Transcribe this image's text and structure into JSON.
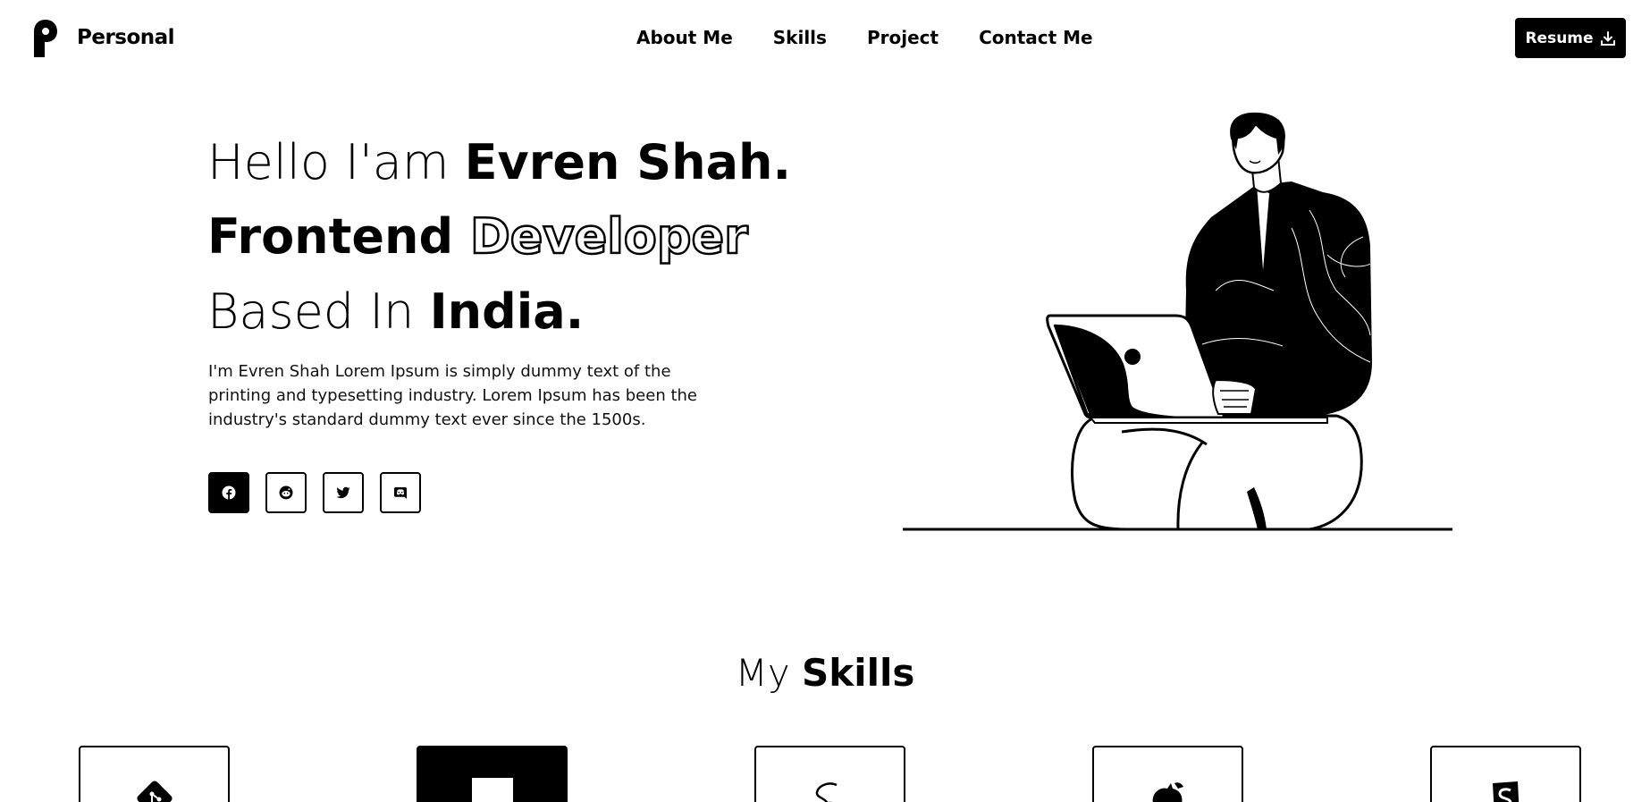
{
  "brand": {
    "name": "Personal",
    "logo_icon": "p-logo-icon"
  },
  "nav": {
    "items": [
      {
        "label": "About Me"
      },
      {
        "label": "Skills"
      },
      {
        "label": "Project"
      },
      {
        "label": "Contact Me"
      }
    ]
  },
  "resume": {
    "label": "Resume",
    "icon": "download-icon"
  },
  "hero": {
    "line1_light": "Hello I'am ",
    "line1_bold": "Evren Shah.",
    "line2_bold": "Frontend ",
    "line2_outline": "Developer",
    "line3_light": "Based In ",
    "line3_bold": "India.",
    "description": "I'm Evren Shah Lorem Ipsum is simply dummy text of the printing and typesetting industry. Lorem Ipsum has been the industry's standard dummy text ever since the 1500s."
  },
  "socials": [
    {
      "icon": "facebook-icon",
      "active": true
    },
    {
      "icon": "reddit-icon",
      "active": false
    },
    {
      "icon": "twitter-icon",
      "active": false
    },
    {
      "icon": "discord-icon",
      "active": false
    }
  ],
  "skills": {
    "title_light": "My ",
    "title_bold": "Skills",
    "items": [
      {
        "icon": "git-icon"
      },
      {
        "icon": "javascript-icon",
        "highlighted": true,
        "label": "JS"
      },
      {
        "icon": "sass-icon"
      },
      {
        "icon": "redux-icon"
      },
      {
        "icon": "storybook-icon"
      }
    ]
  },
  "colors": {
    "primary": "#000000",
    "background": "#ffffff"
  }
}
